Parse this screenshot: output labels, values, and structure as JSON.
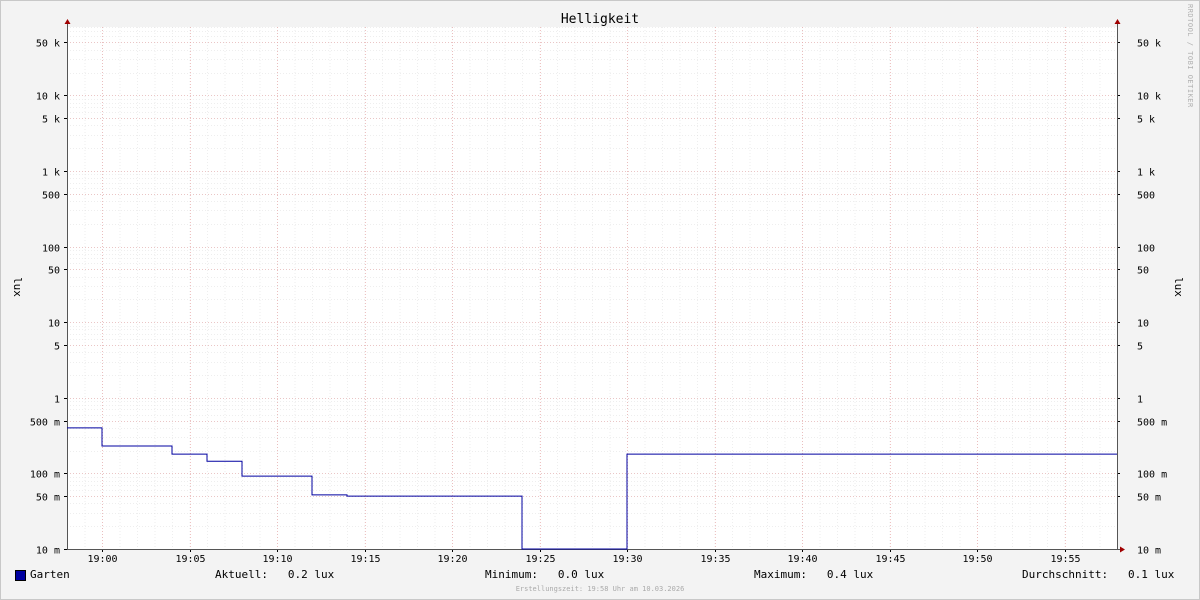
{
  "chart_data": {
    "type": "line",
    "title": "Helligkeit",
    "ylabel": "lux",
    "yscale": "log",
    "ylim_lux": [
      0.01,
      80000
    ],
    "xlim": [
      "18:58",
      "19:58"
    ],
    "x_ticks": [
      "19:00",
      "19:05",
      "19:10",
      "19:15",
      "19:20",
      "19:25",
      "19:30",
      "19:35",
      "19:40",
      "19:45",
      "19:50",
      "19:55"
    ],
    "y_ticks": [
      {
        "value": 50000,
        "label": "50 k"
      },
      {
        "value": 10000,
        "label": "10 k"
      },
      {
        "value": 5000,
        "label": "5 k"
      },
      {
        "value": 1000,
        "label": "1 k"
      },
      {
        "value": 500,
        "label": "500"
      },
      {
        "value": 100,
        "label": "100"
      },
      {
        "value": 50,
        "label": "50"
      },
      {
        "value": 10,
        "label": "10"
      },
      {
        "value": 5,
        "label": "5"
      },
      {
        "value": 1,
        "label": "1"
      },
      {
        "value": 0.5,
        "label": "500 m"
      },
      {
        "value": 0.1,
        "label": "100 m"
      },
      {
        "value": 0.05,
        "label": "50 m"
      },
      {
        "value": 0.01,
        "label": "10 m"
      }
    ],
    "grid": true,
    "series": [
      {
        "name": "Garten",
        "color": "#0000a0",
        "step": true,
        "points": [
          {
            "x": "18:58",
            "y": 0.4
          },
          {
            "x": "19:00",
            "y": 0.23
          },
          {
            "x": "19:04",
            "y": 0.18
          },
          {
            "x": "19:06",
            "y": 0.145
          },
          {
            "x": "19:08",
            "y": 0.092
          },
          {
            "x": "19:12",
            "y": 0.052
          },
          {
            "x": "19:14",
            "y": 0.05
          },
          {
            "x": "19:24",
            "y": 0.01
          },
          {
            "x": "19:30",
            "y": 0.18
          },
          {
            "x": "19:58",
            "y": 0.18
          }
        ]
      }
    ]
  },
  "legend": {
    "series_name": "Garten",
    "current": "Aktuell:   0.2 lux",
    "minimum": "Minimum:   0.0 lux",
    "maximum": "Maximum:   0.4 lux",
    "average": "Durchschnitt:   0.1 lux"
  },
  "footer": "Erstellungszeit: 19:58 Uhr am 10.03.2026",
  "credit": "RRDTOOL / TOBI OETIKER"
}
